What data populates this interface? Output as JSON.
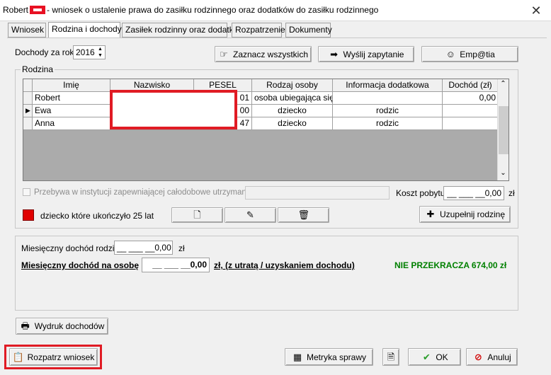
{
  "window": {
    "title_prefix": "Robert",
    "title_suffix": "- wniosek o ustalenie prawa do zasiłku rodzinnego oraz dodatków do zasiłku rodzinnego",
    "close_glyph": "✕"
  },
  "tabs": [
    {
      "label": "Wniosek"
    },
    {
      "label": "Rodzina i dochody"
    },
    {
      "label": "Zasiłek rodzinny oraz dodatki"
    },
    {
      "label": "Rozpatrzenie"
    },
    {
      "label": "Dokumenty"
    }
  ],
  "top": {
    "year_label": "Dochody za rok",
    "year_value": "2016",
    "btn_select_all": "Zaznacz wszystkich",
    "btn_send_query": "Wyślij zapytanie",
    "btn_empatia": "Emp@tia"
  },
  "family": {
    "group_label": "Rodzina",
    "columns": [
      "Imię",
      "Nazwisko",
      "PESEL",
      "Rodzaj osoby",
      "Informacja dodatkowa",
      "Dochód (zł)"
    ],
    "rows": [
      {
        "imie": "Robert",
        "nazwisko": "",
        "pesel": "01",
        "rodzaj": "osoba ubiegająca się",
        "info": "",
        "dochod": "0,00"
      },
      {
        "imie": "Ewa",
        "nazwisko": "",
        "pesel": "00",
        "rodzaj": "dziecko",
        "info": "rodzic",
        "dochod": ""
      },
      {
        "imie": "Anna",
        "nazwisko": "",
        "pesel": "47",
        "rodzaj": "dziecko",
        "info": "rodzic",
        "dochod": ""
      }
    ],
    "institution_label": "Przebywa w instytucji zapewniającej całodobowe utrzymanie :",
    "koszt_label": "Koszt pobytu",
    "koszt_value": "__ ___ __0,00",
    "koszt_unit": "zł",
    "legend_label": "dziecko które ukończyło 25 lat",
    "btn_complete": "Uzupełnij rodzinę"
  },
  "income": {
    "monthly_family_label": "Miesięczny dochód rodziny",
    "monthly_family_value": "__ ___ __0,00",
    "monthly_family_unit": "zł",
    "per_person_label": "Miesięczny dochód na osobę",
    "per_person_value": "__ ___ __0,00",
    "per_person_suffix": "zł, (z utratą / uzyskaniem dochodu)",
    "status": "NIE PRZEKRACZA 674,00 zł"
  },
  "bottom": {
    "btn_print": "Wydruk dochodów",
    "btn_review": "Rozpatrz wniosek",
    "btn_metric": "Metryka sprawy",
    "btn_ok": "OK",
    "btn_cancel": "Anuluj"
  },
  "colors": {
    "accent_red": "#e01b24",
    "status_green": "#008000"
  }
}
